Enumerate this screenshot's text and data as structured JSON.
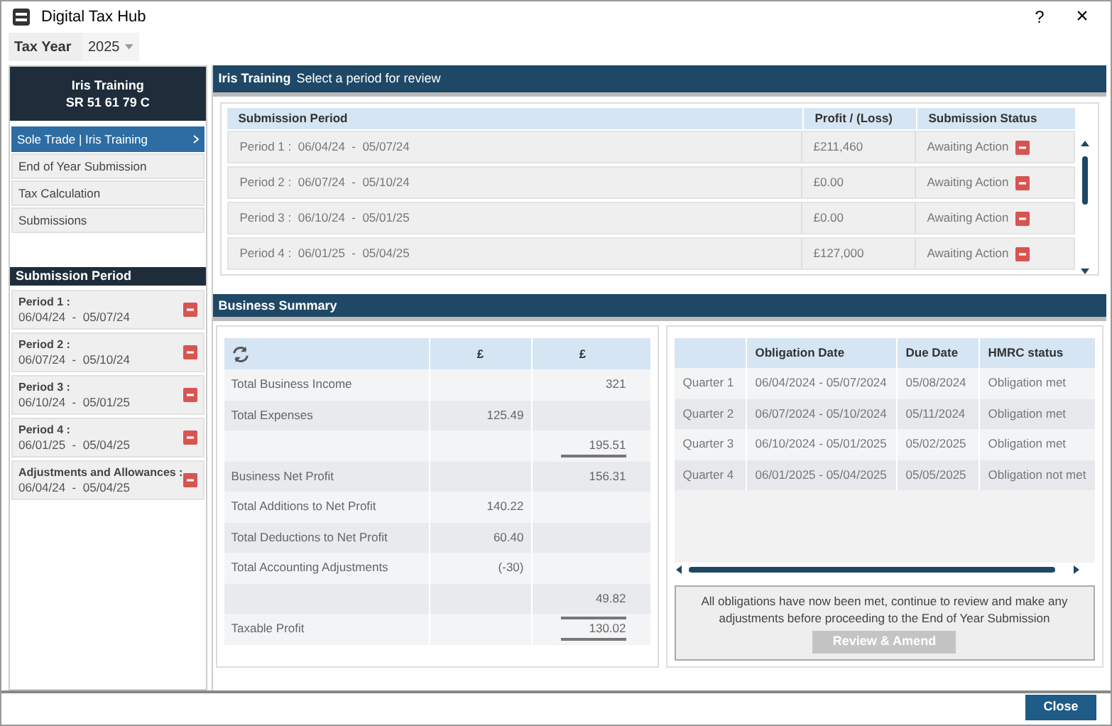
{
  "window": {
    "title": "Digital Tax Hub",
    "help": "?",
    "close": "×"
  },
  "tax_year": {
    "label": "Tax Year",
    "value": "2025"
  },
  "client": {
    "name": "Iris Training",
    "reference": "SR 51 61 79 C"
  },
  "nav": [
    {
      "label": "Sole Trade | Iris Training",
      "selected": true
    },
    {
      "label": "End of Year Submission",
      "selected": false
    },
    {
      "label": "Tax Calculation",
      "selected": false
    },
    {
      "label": "Submissions",
      "selected": false
    }
  ],
  "sidebar_periods": {
    "title": "Submission Period",
    "items": [
      {
        "label": "Period 1 :",
        "dates": "06/04/24  -  05/07/24"
      },
      {
        "label": "Period 2 :",
        "dates": "06/07/24  -  05/10/24"
      },
      {
        "label": "Period 3 :",
        "dates": "06/10/24  -  05/01/25"
      },
      {
        "label": "Period 4 :",
        "dates": "06/01/25  -  05/04/25"
      },
      {
        "label": "Adjustments and Allowances :",
        "dates": "06/04/24  -  05/04/25"
      }
    ]
  },
  "periods_header": {
    "title": "Iris Training",
    "subtitle": "Select a period for review"
  },
  "periods_table": {
    "columns": [
      "Submission Period",
      "Profit / (Loss)",
      "Submission Status"
    ],
    "rows": [
      {
        "period": "Period 1 :  06/04/24  -  05/07/24",
        "profit": "£211,460",
        "status": "Awaiting Action"
      },
      {
        "period": "Period 2 :  06/07/24  -  05/10/24",
        "profit": "£0.00",
        "status": "Awaiting Action"
      },
      {
        "period": "Period 3 :  06/10/24  -  05/01/25",
        "profit": "£0.00",
        "status": "Awaiting Action"
      },
      {
        "period": "Period 4 :  06/01/25  -  05/04/25",
        "profit": "£127,000",
        "status": "Awaiting Action"
      }
    ]
  },
  "business_summary": {
    "title": "Business Summary",
    "columns": [
      "£",
      "£"
    ],
    "rows": [
      {
        "label": "Total Business Income",
        "col_1": "",
        "col_2": "321"
      },
      {
        "label": "Total Expenses",
        "col_1": "125.49",
        "col_2": ""
      },
      {
        "label": "",
        "col_1": "",
        "col_2": "195.51",
        "underlined": true
      },
      {
        "label": "Business Net Profit",
        "col_1": "",
        "col_2": "156.31"
      },
      {
        "label": "Total Additions to Net Profit",
        "col_1": "140.22",
        "col_2": ""
      },
      {
        "label": "Total Deductions to Net Profit",
        "col_1": "60.40",
        "col_2": ""
      },
      {
        "label": "Total Accounting Adjustments",
        "col_1": "(-30)",
        "col_2": ""
      },
      {
        "label": "",
        "col_1": "",
        "col_2": "49.82"
      },
      {
        "label": "Taxable Profit",
        "col_1": "",
        "col_2": "130.02",
        "overlined": true,
        "underlined": true
      }
    ]
  },
  "obligations": {
    "columns": [
      "Obligation Date",
      "Due Date",
      "HMRC status"
    ],
    "rows": [
      {
        "quarter": "Quarter 1",
        "dates": "06/04/2024 - 05/07/2024",
        "due": "05/08/2024",
        "status": "Obligation met"
      },
      {
        "quarter": "Quarter 2",
        "dates": "06/07/2024 - 05/10/2024",
        "due": "05/11/2024",
        "status": "Obligation met"
      },
      {
        "quarter": "Quarter 3",
        "dates": "06/10/2024 - 05/01/2025",
        "due": "05/02/2025",
        "status": "Obligation met"
      },
      {
        "quarter": "Quarter 4",
        "dates": "06/01/2025 - 05/04/2025",
        "due": "05/05/2025",
        "status": "Obligation not met"
      }
    ],
    "message": "All obligations have now been met, continue to review and make any adjustments before proceeding to the End of Year Submission",
    "button": {
      "label": "Review & Amend",
      "disabled": true
    }
  },
  "close_button": "Close"
}
